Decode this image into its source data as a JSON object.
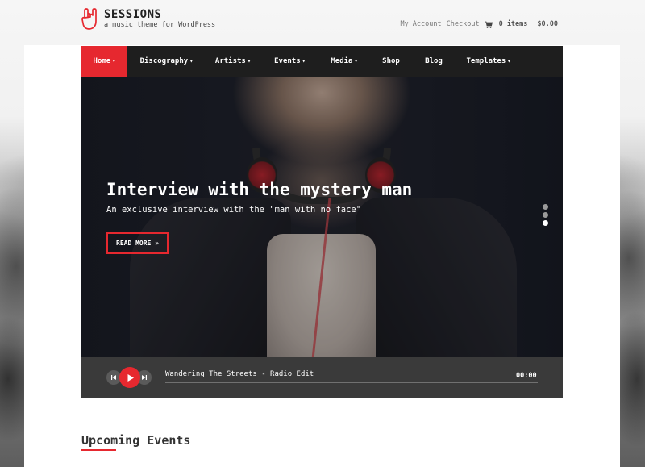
{
  "site": {
    "title": "SESSIONS",
    "tagline": "a music theme for WordPress",
    "logo_icon": "rock-hand-icon"
  },
  "header_links": {
    "my_account": "My Account",
    "checkout": "Checkout",
    "cart_count": "0 items",
    "cart_total": "$0.00"
  },
  "nav": {
    "items": [
      {
        "label": "Home",
        "caret": "▾",
        "active": true
      },
      {
        "label": "Discography",
        "caret": "▾"
      },
      {
        "label": "Artists",
        "caret": "▾"
      },
      {
        "label": "Events",
        "caret": "▾"
      },
      {
        "label": "Media",
        "caret": "▾"
      },
      {
        "label": "Shop",
        "caret": ""
      },
      {
        "label": "Blog",
        "caret": ""
      },
      {
        "label": "Templates",
        "caret": "▾"
      }
    ]
  },
  "hero": {
    "title": "Interview with the mystery man",
    "subtitle": "An exclusive interview with the \"man with no face\"",
    "button": "READ MORE »",
    "active_slide": 3,
    "slide_count": 3
  },
  "player": {
    "track": "Wandering The Streets - Radio Edit",
    "time": "00:00",
    "progress": 0
  },
  "events": {
    "heading": "Upcoming Events"
  },
  "colors": {
    "accent": "#e6282f",
    "nav_bg": "#1e1e1e",
    "player_bg": "#3a3a3a"
  }
}
